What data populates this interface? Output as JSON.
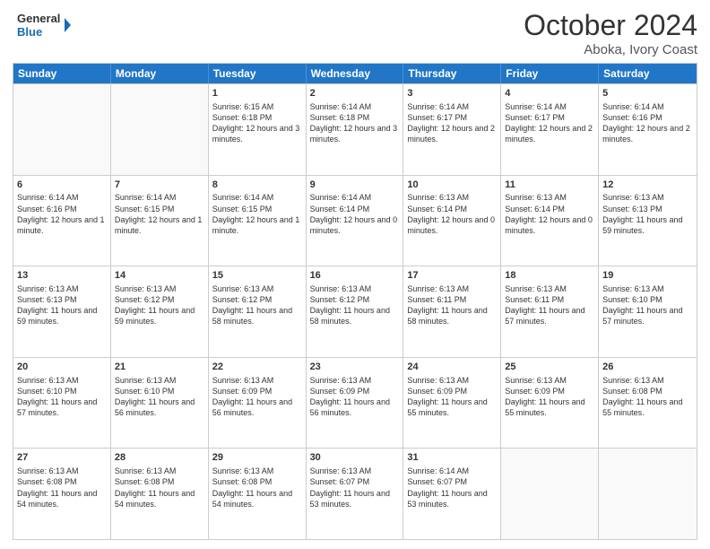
{
  "logo": {
    "line1": "General",
    "line2": "Blue"
  },
  "title": "October 2024",
  "subtitle": "Aboka, Ivory Coast",
  "header_days": [
    "Sunday",
    "Monday",
    "Tuesday",
    "Wednesday",
    "Thursday",
    "Friday",
    "Saturday"
  ],
  "weeks": [
    [
      {
        "day": "",
        "info": "",
        "empty": true
      },
      {
        "day": "",
        "info": "",
        "empty": true
      },
      {
        "day": "1",
        "info": "Sunrise: 6:15 AM\nSunset: 6:18 PM\nDaylight: 12 hours and 3 minutes.",
        "empty": false
      },
      {
        "day": "2",
        "info": "Sunrise: 6:14 AM\nSunset: 6:18 PM\nDaylight: 12 hours and 3 minutes.",
        "empty": false
      },
      {
        "day": "3",
        "info": "Sunrise: 6:14 AM\nSunset: 6:17 PM\nDaylight: 12 hours and 2 minutes.",
        "empty": false
      },
      {
        "day": "4",
        "info": "Sunrise: 6:14 AM\nSunset: 6:17 PM\nDaylight: 12 hours and 2 minutes.",
        "empty": false
      },
      {
        "day": "5",
        "info": "Sunrise: 6:14 AM\nSunset: 6:16 PM\nDaylight: 12 hours and 2 minutes.",
        "empty": false
      }
    ],
    [
      {
        "day": "6",
        "info": "Sunrise: 6:14 AM\nSunset: 6:16 PM\nDaylight: 12 hours and 1 minute.",
        "empty": false
      },
      {
        "day": "7",
        "info": "Sunrise: 6:14 AM\nSunset: 6:15 PM\nDaylight: 12 hours and 1 minute.",
        "empty": false
      },
      {
        "day": "8",
        "info": "Sunrise: 6:14 AM\nSunset: 6:15 PM\nDaylight: 12 hours and 1 minute.",
        "empty": false
      },
      {
        "day": "9",
        "info": "Sunrise: 6:14 AM\nSunset: 6:14 PM\nDaylight: 12 hours and 0 minutes.",
        "empty": false
      },
      {
        "day": "10",
        "info": "Sunrise: 6:13 AM\nSunset: 6:14 PM\nDaylight: 12 hours and 0 minutes.",
        "empty": false
      },
      {
        "day": "11",
        "info": "Sunrise: 6:13 AM\nSunset: 6:14 PM\nDaylight: 12 hours and 0 minutes.",
        "empty": false
      },
      {
        "day": "12",
        "info": "Sunrise: 6:13 AM\nSunset: 6:13 PM\nDaylight: 11 hours and 59 minutes.",
        "empty": false
      }
    ],
    [
      {
        "day": "13",
        "info": "Sunrise: 6:13 AM\nSunset: 6:13 PM\nDaylight: 11 hours and 59 minutes.",
        "empty": false
      },
      {
        "day": "14",
        "info": "Sunrise: 6:13 AM\nSunset: 6:12 PM\nDaylight: 11 hours and 59 minutes.",
        "empty": false
      },
      {
        "day": "15",
        "info": "Sunrise: 6:13 AM\nSunset: 6:12 PM\nDaylight: 11 hours and 58 minutes.",
        "empty": false
      },
      {
        "day": "16",
        "info": "Sunrise: 6:13 AM\nSunset: 6:12 PM\nDaylight: 11 hours and 58 minutes.",
        "empty": false
      },
      {
        "day": "17",
        "info": "Sunrise: 6:13 AM\nSunset: 6:11 PM\nDaylight: 11 hours and 58 minutes.",
        "empty": false
      },
      {
        "day": "18",
        "info": "Sunrise: 6:13 AM\nSunset: 6:11 PM\nDaylight: 11 hours and 57 minutes.",
        "empty": false
      },
      {
        "day": "19",
        "info": "Sunrise: 6:13 AM\nSunset: 6:10 PM\nDaylight: 11 hours and 57 minutes.",
        "empty": false
      }
    ],
    [
      {
        "day": "20",
        "info": "Sunrise: 6:13 AM\nSunset: 6:10 PM\nDaylight: 11 hours and 57 minutes.",
        "empty": false
      },
      {
        "day": "21",
        "info": "Sunrise: 6:13 AM\nSunset: 6:10 PM\nDaylight: 11 hours and 56 minutes.",
        "empty": false
      },
      {
        "day": "22",
        "info": "Sunrise: 6:13 AM\nSunset: 6:09 PM\nDaylight: 11 hours and 56 minutes.",
        "empty": false
      },
      {
        "day": "23",
        "info": "Sunrise: 6:13 AM\nSunset: 6:09 PM\nDaylight: 11 hours and 56 minutes.",
        "empty": false
      },
      {
        "day": "24",
        "info": "Sunrise: 6:13 AM\nSunset: 6:09 PM\nDaylight: 11 hours and 55 minutes.",
        "empty": false
      },
      {
        "day": "25",
        "info": "Sunrise: 6:13 AM\nSunset: 6:09 PM\nDaylight: 11 hours and 55 minutes.",
        "empty": false
      },
      {
        "day": "26",
        "info": "Sunrise: 6:13 AM\nSunset: 6:08 PM\nDaylight: 11 hours and 55 minutes.",
        "empty": false
      }
    ],
    [
      {
        "day": "27",
        "info": "Sunrise: 6:13 AM\nSunset: 6:08 PM\nDaylight: 11 hours and 54 minutes.",
        "empty": false
      },
      {
        "day": "28",
        "info": "Sunrise: 6:13 AM\nSunset: 6:08 PM\nDaylight: 11 hours and 54 minutes.",
        "empty": false
      },
      {
        "day": "29",
        "info": "Sunrise: 6:13 AM\nSunset: 6:08 PM\nDaylight: 11 hours and 54 minutes.",
        "empty": false
      },
      {
        "day": "30",
        "info": "Sunrise: 6:13 AM\nSunset: 6:07 PM\nDaylight: 11 hours and 53 minutes.",
        "empty": false
      },
      {
        "day": "31",
        "info": "Sunrise: 6:14 AM\nSunset: 6:07 PM\nDaylight: 11 hours and 53 minutes.",
        "empty": false
      },
      {
        "day": "",
        "info": "",
        "empty": true
      },
      {
        "day": "",
        "info": "",
        "empty": true
      }
    ]
  ]
}
